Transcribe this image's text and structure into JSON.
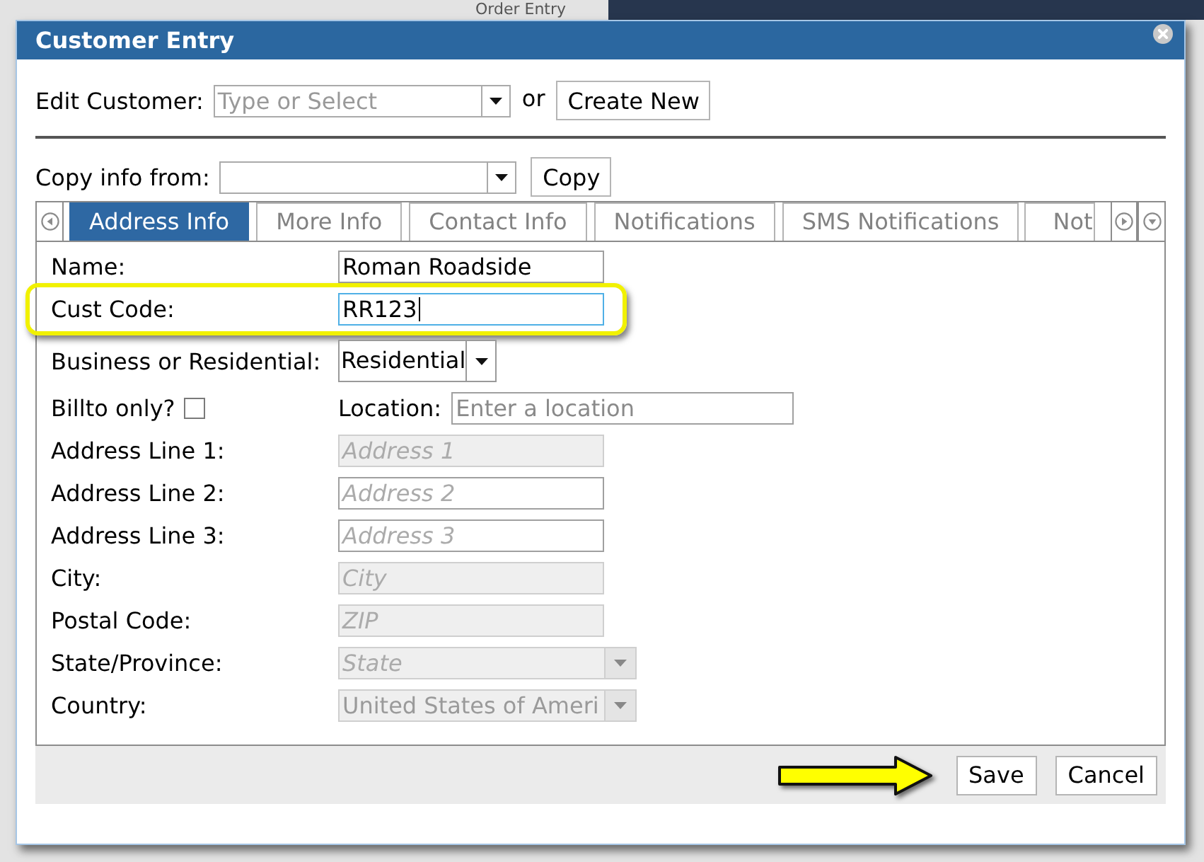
{
  "background_page": {
    "title": "Order Entry"
  },
  "dialog": {
    "title": "Customer Entry"
  },
  "edit_customer": {
    "label": "Edit Customer:",
    "placeholder": "Type or Select",
    "separator": "or",
    "button": "Create New"
  },
  "copy_info": {
    "label": "Copy info from:",
    "button": "Copy"
  },
  "tabs": [
    {
      "label": "Address Info",
      "selected": true
    },
    {
      "label": "More Info",
      "selected": false
    },
    {
      "label": "Contact Info",
      "selected": false
    },
    {
      "label": "Notifications",
      "selected": false
    },
    {
      "label": "SMS Notifications",
      "selected": false
    },
    {
      "label": "Not",
      "selected": false
    }
  ],
  "fields": [
    {
      "kind": "text",
      "label": "Name:",
      "value": "Roman Roadside",
      "disabled": false,
      "focused": false,
      "highlighted": false
    },
    {
      "kind": "text",
      "label": "Cust Code:",
      "value": "RR123",
      "disabled": false,
      "focused": true,
      "highlighted": true
    },
    {
      "kind": "native_select",
      "label": "Business or Residential:",
      "value": "Residential",
      "disabled": false,
      "highlighted": false
    },
    {
      "kind": "checkbox",
      "label": "Billto only?",
      "checked": false,
      "highlighted": false,
      "location": {
        "label": "Location:",
        "placeholder": "Enter a location"
      }
    },
    {
      "kind": "text",
      "label": "Address Line 1:",
      "placeholder": "Address 1",
      "disabled": true,
      "focused": false,
      "highlighted": false
    },
    {
      "kind": "text",
      "label": "Address Line 2:",
      "placeholder": "Address 2",
      "disabled": false,
      "focused": false,
      "highlighted": false
    },
    {
      "kind": "text",
      "label": "Address Line 3:",
      "placeholder": "Address 3",
      "disabled": false,
      "focused": false,
      "highlighted": false
    },
    {
      "kind": "text",
      "label": "City:",
      "placeholder": "City",
      "disabled": true,
      "focused": false,
      "highlighted": false
    },
    {
      "kind": "text",
      "label": "Postal Code:",
      "placeholder": "ZIP",
      "disabled": true,
      "focused": false,
      "highlighted": false
    },
    {
      "kind": "dropdown",
      "label": "State/Province:",
      "placeholder": "State",
      "disabled": true,
      "highlighted": false
    },
    {
      "kind": "dropdown",
      "label": "Country:",
      "value": "United States of Ameri",
      "disabled": true,
      "highlighted": false
    }
  ],
  "buttons": [
    {
      "label": "Save",
      "pointed_at": true
    },
    {
      "label": "Cancel",
      "pointed_at": false
    }
  ]
}
